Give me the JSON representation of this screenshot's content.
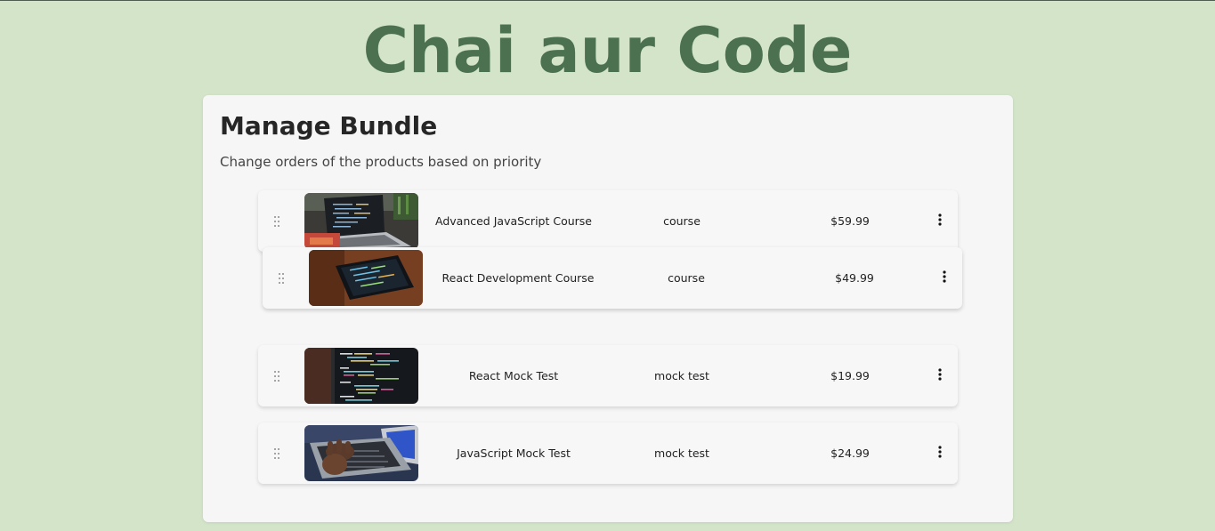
{
  "header": {
    "site_title": "Chai aur Code"
  },
  "bundle": {
    "title": "Manage Bundle",
    "subtitle": "Change orders of the products based on priority",
    "products": [
      {
        "name": "Advanced JavaScript Course",
        "type": "course",
        "price": "$59.99",
        "thumbnail": "laptop-code-image"
      },
      {
        "name": "React Development Course",
        "type": "course",
        "price": "$49.99",
        "thumbnail": "phone-code-image"
      },
      {
        "name": "React Mock Test",
        "type": "mock test",
        "price": "$19.99",
        "thumbnail": "code-screen-image"
      },
      {
        "name": "JavaScript Mock Test",
        "type": "mock test",
        "price": "$24.99",
        "thumbnail": "typing-laptop-image"
      }
    ]
  },
  "icons": {
    "drag": "drag-handle-icon",
    "menu": "more-vertical-icon"
  },
  "colors": {
    "background": "#d3e4c9",
    "title": "#4b7150",
    "panel": "#f6f6f6"
  }
}
